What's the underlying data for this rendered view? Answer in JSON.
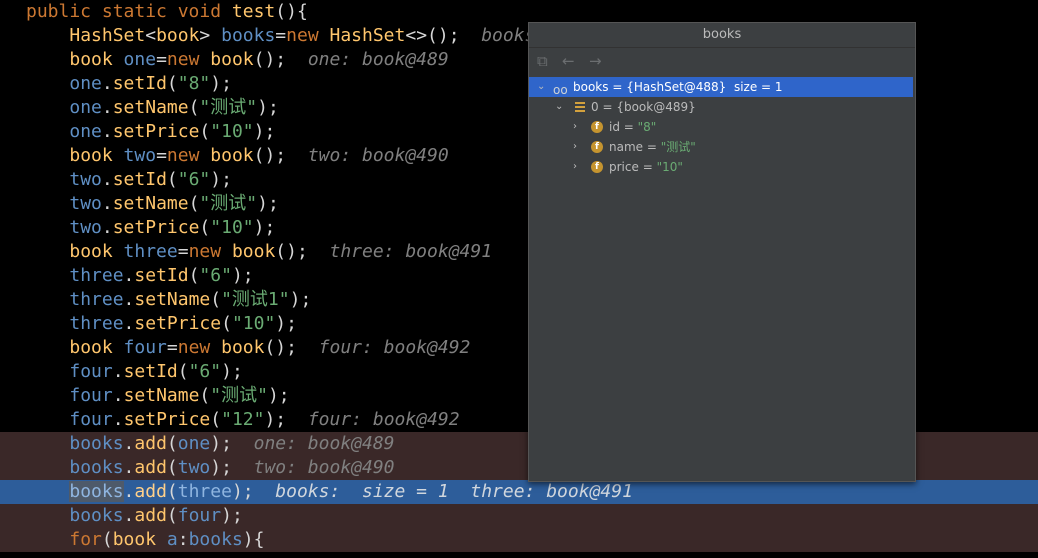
{
  "editor": {
    "lines": [
      {
        "parts": [
          [
            "kw",
            "public static void "
          ],
          [
            "fn",
            "test"
          ],
          [
            "op",
            "(){"
          ]
        ]
      },
      {
        "parts": [
          [
            "ind",
            "    "
          ],
          [
            "ty",
            "HashSet"
          ],
          [
            "op",
            "<"
          ],
          [
            "ty",
            "book"
          ],
          [
            "op",
            "> "
          ],
          [
            "var",
            "books"
          ],
          [
            "op",
            "="
          ],
          [
            "kw",
            "new "
          ],
          [
            "ty",
            "HashSet"
          ],
          [
            "op",
            "<>();"
          ],
          [
            "hint",
            "  books: "
          ]
        ]
      },
      {
        "parts": [
          [
            "ind",
            "    "
          ],
          [
            "ty",
            "book "
          ],
          [
            "var",
            "one"
          ],
          [
            "op",
            "="
          ],
          [
            "kw",
            "new "
          ],
          [
            "ty",
            "book"
          ],
          [
            "op",
            "();"
          ],
          [
            "hint",
            "  one: book@489"
          ]
        ]
      },
      {
        "parts": [
          [
            "ind",
            "    "
          ],
          [
            "var",
            "one"
          ],
          [
            "op",
            "."
          ],
          [
            "fn",
            "setId"
          ],
          [
            "op",
            "("
          ],
          [
            "str",
            "\"8\""
          ],
          [
            "op",
            ");"
          ]
        ]
      },
      {
        "parts": [
          [
            "ind",
            "    "
          ],
          [
            "var",
            "one"
          ],
          [
            "op",
            "."
          ],
          [
            "fn",
            "setName"
          ],
          [
            "op",
            "("
          ],
          [
            "str",
            "\"测试\""
          ],
          [
            "op",
            ");"
          ]
        ]
      },
      {
        "parts": [
          [
            "ind",
            "    "
          ],
          [
            "var",
            "one"
          ],
          [
            "op",
            "."
          ],
          [
            "fn",
            "setPrice"
          ],
          [
            "op",
            "("
          ],
          [
            "str",
            "\"10\""
          ],
          [
            "op",
            ");"
          ]
        ]
      },
      {
        "parts": [
          [
            "ind",
            "    "
          ],
          [
            "ty",
            "book "
          ],
          [
            "var",
            "two"
          ],
          [
            "op",
            "="
          ],
          [
            "kw",
            "new "
          ],
          [
            "ty",
            "book"
          ],
          [
            "op",
            "();"
          ],
          [
            "hint",
            "  two: book@490"
          ]
        ]
      },
      {
        "parts": [
          [
            "ind",
            "    "
          ],
          [
            "var",
            "two"
          ],
          [
            "op",
            "."
          ],
          [
            "fn",
            "setId"
          ],
          [
            "op",
            "("
          ],
          [
            "str",
            "\"6\""
          ],
          [
            "op",
            ");"
          ]
        ]
      },
      {
        "parts": [
          [
            "ind",
            "    "
          ],
          [
            "var",
            "two"
          ],
          [
            "op",
            "."
          ],
          [
            "fn",
            "setName"
          ],
          [
            "op",
            "("
          ],
          [
            "str",
            "\"测试\""
          ],
          [
            "op",
            ");"
          ]
        ]
      },
      {
        "parts": [
          [
            "ind",
            "    "
          ],
          [
            "var",
            "two"
          ],
          [
            "op",
            "."
          ],
          [
            "fn",
            "setPrice"
          ],
          [
            "op",
            "("
          ],
          [
            "str",
            "\"10\""
          ],
          [
            "op",
            ");"
          ]
        ]
      },
      {
        "parts": [
          [
            "ind",
            "    "
          ],
          [
            "ty",
            "book "
          ],
          [
            "var",
            "three"
          ],
          [
            "op",
            "="
          ],
          [
            "kw",
            "new "
          ],
          [
            "ty",
            "book"
          ],
          [
            "op",
            "();"
          ],
          [
            "hint",
            "  three: book@491"
          ]
        ]
      },
      {
        "parts": [
          [
            "ind",
            "    "
          ],
          [
            "var",
            "three"
          ],
          [
            "op",
            "."
          ],
          [
            "fn",
            "setId"
          ],
          [
            "op",
            "("
          ],
          [
            "str",
            "\"6\""
          ],
          [
            "op",
            ");"
          ]
        ]
      },
      {
        "parts": [
          [
            "ind",
            "    "
          ],
          [
            "var",
            "three"
          ],
          [
            "op",
            "."
          ],
          [
            "fn",
            "setName"
          ],
          [
            "op",
            "("
          ],
          [
            "str",
            "\"测试1\""
          ],
          [
            "op",
            ");"
          ]
        ]
      },
      {
        "parts": [
          [
            "ind",
            "    "
          ],
          [
            "var",
            "three"
          ],
          [
            "op",
            "."
          ],
          [
            "fn",
            "setPrice"
          ],
          [
            "op",
            "("
          ],
          [
            "str",
            "\"10\""
          ],
          [
            "op",
            ");"
          ]
        ]
      },
      {
        "parts": [
          [
            "ind",
            "    "
          ],
          [
            "ty",
            "book "
          ],
          [
            "var",
            "four"
          ],
          [
            "op",
            "="
          ],
          [
            "kw",
            "new "
          ],
          [
            "ty",
            "book"
          ],
          [
            "op",
            "();"
          ],
          [
            "hint",
            "  four: book@492"
          ]
        ]
      },
      {
        "parts": [
          [
            "ind",
            "    "
          ],
          [
            "var",
            "four"
          ],
          [
            "op",
            "."
          ],
          [
            "fn",
            "setId"
          ],
          [
            "op",
            "("
          ],
          [
            "str",
            "\"6\""
          ],
          [
            "op",
            ");"
          ]
        ]
      },
      {
        "parts": [
          [
            "ind",
            "    "
          ],
          [
            "var",
            "four"
          ],
          [
            "op",
            "."
          ],
          [
            "fn",
            "setName"
          ],
          [
            "op",
            "("
          ],
          [
            "str",
            "\"测试\""
          ],
          [
            "op",
            ");"
          ]
        ]
      },
      {
        "parts": [
          [
            "ind",
            "    "
          ],
          [
            "var",
            "four"
          ],
          [
            "op",
            "."
          ],
          [
            "fn",
            "setPrice"
          ],
          [
            "op",
            "("
          ],
          [
            "str",
            "\"12\""
          ],
          [
            "op",
            ");"
          ],
          [
            "hint",
            "  four: book@492"
          ]
        ]
      },
      {
        "style": "bp",
        "parts": [
          [
            "ind",
            "    "
          ],
          [
            "var",
            "books"
          ],
          [
            "op",
            "."
          ],
          [
            "fn",
            "add"
          ],
          [
            "op",
            "("
          ],
          [
            "var",
            "one"
          ],
          [
            "op",
            ");"
          ],
          [
            "hint",
            "  one: book@489"
          ]
        ]
      },
      {
        "style": "bp",
        "parts": [
          [
            "ind",
            "    "
          ],
          [
            "var",
            "books"
          ],
          [
            "op",
            "."
          ],
          [
            "fn",
            "add"
          ],
          [
            "op",
            "("
          ],
          [
            "var",
            "two"
          ],
          [
            "op",
            ");"
          ],
          [
            "hint",
            "  two: book@490"
          ]
        ]
      },
      {
        "style": "cur",
        "parts": [
          [
            "ind",
            "    "
          ],
          [
            "varhl",
            "books"
          ],
          [
            "op",
            "."
          ],
          [
            "fn",
            "add"
          ],
          [
            "op",
            "("
          ],
          [
            "var",
            "three"
          ],
          [
            "op",
            ");"
          ],
          [
            "hintcur",
            "  books:  size = 1  three: book@491"
          ]
        ]
      },
      {
        "style": "bp",
        "parts": [
          [
            "ind",
            "    "
          ],
          [
            "var",
            "books"
          ],
          [
            "op",
            "."
          ],
          [
            "fn",
            "add"
          ],
          [
            "op",
            "("
          ],
          [
            "var",
            "four"
          ],
          [
            "op",
            ");"
          ]
        ]
      },
      {
        "style": "bp",
        "parts": [
          [
            "ind",
            "    "
          ],
          [
            "kw",
            "for"
          ],
          [
            "op",
            "("
          ],
          [
            "ty",
            "book "
          ],
          [
            "var",
            "a"
          ],
          [
            "op",
            ":"
          ],
          [
            "var",
            "books"
          ],
          [
            "op",
            "){"
          ]
        ]
      }
    ]
  },
  "popup": {
    "title": "books",
    "toolbar_icons": [
      "copy-icon",
      "back-arrow-icon",
      "forward-arrow-icon"
    ],
    "tree": {
      "root": {
        "name": "books",
        "value": "{HashSet@488}  size = 1"
      },
      "child": {
        "name": "0",
        "value": "{book@489}"
      },
      "fields": [
        {
          "name": "id",
          "value": "\"8\""
        },
        {
          "name": "name",
          "value": "\"测试\""
        },
        {
          "name": "price",
          "value": "\"10\""
        }
      ]
    }
  },
  "colors": {
    "background": "#000000",
    "keyword": "#cc7832",
    "string": "#6aab73",
    "breakpoint_line": "#3a2828",
    "current_line": "#2d5d9a",
    "popup_bg": "#3c3f41",
    "selection": "#2f65ca"
  }
}
